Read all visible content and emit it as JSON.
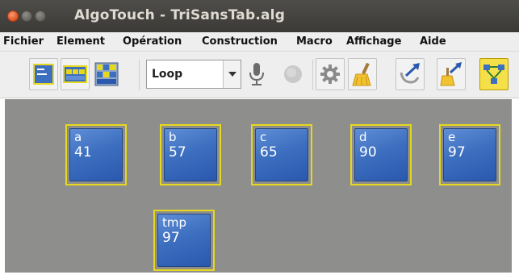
{
  "window": {
    "title": "AlgoTouch - TriSansTab.alg"
  },
  "menubar": {
    "items": [
      "Fichier",
      "Element",
      "Opération",
      "Construction",
      "Macro",
      "Affichage",
      "Aide"
    ]
  },
  "toolbar": {
    "mode_select": {
      "value": "Loop"
    },
    "icons": [
      "new-variable-icon",
      "new-array-icon",
      "new-matrix-icon",
      "microphone-icon",
      "record-icon",
      "settings-gear-icon",
      "broom-clear-icon",
      "undo-arrow-icon",
      "redo-broom-icon",
      "network-layout-icon"
    ]
  },
  "variables": [
    {
      "name": "a",
      "value": "41"
    },
    {
      "name": "b",
      "value": "57"
    },
    {
      "name": "c",
      "value": "65"
    },
    {
      "name": "d",
      "value": "90"
    },
    {
      "name": "e",
      "value": "97"
    },
    {
      "name": "tmp",
      "value": "97"
    }
  ],
  "colors": {
    "titlebar": "#3b3a37",
    "canvas": "#8e8e8c",
    "variable_fill": "#3d6fc0",
    "variable_border": "#e6d81e"
  }
}
